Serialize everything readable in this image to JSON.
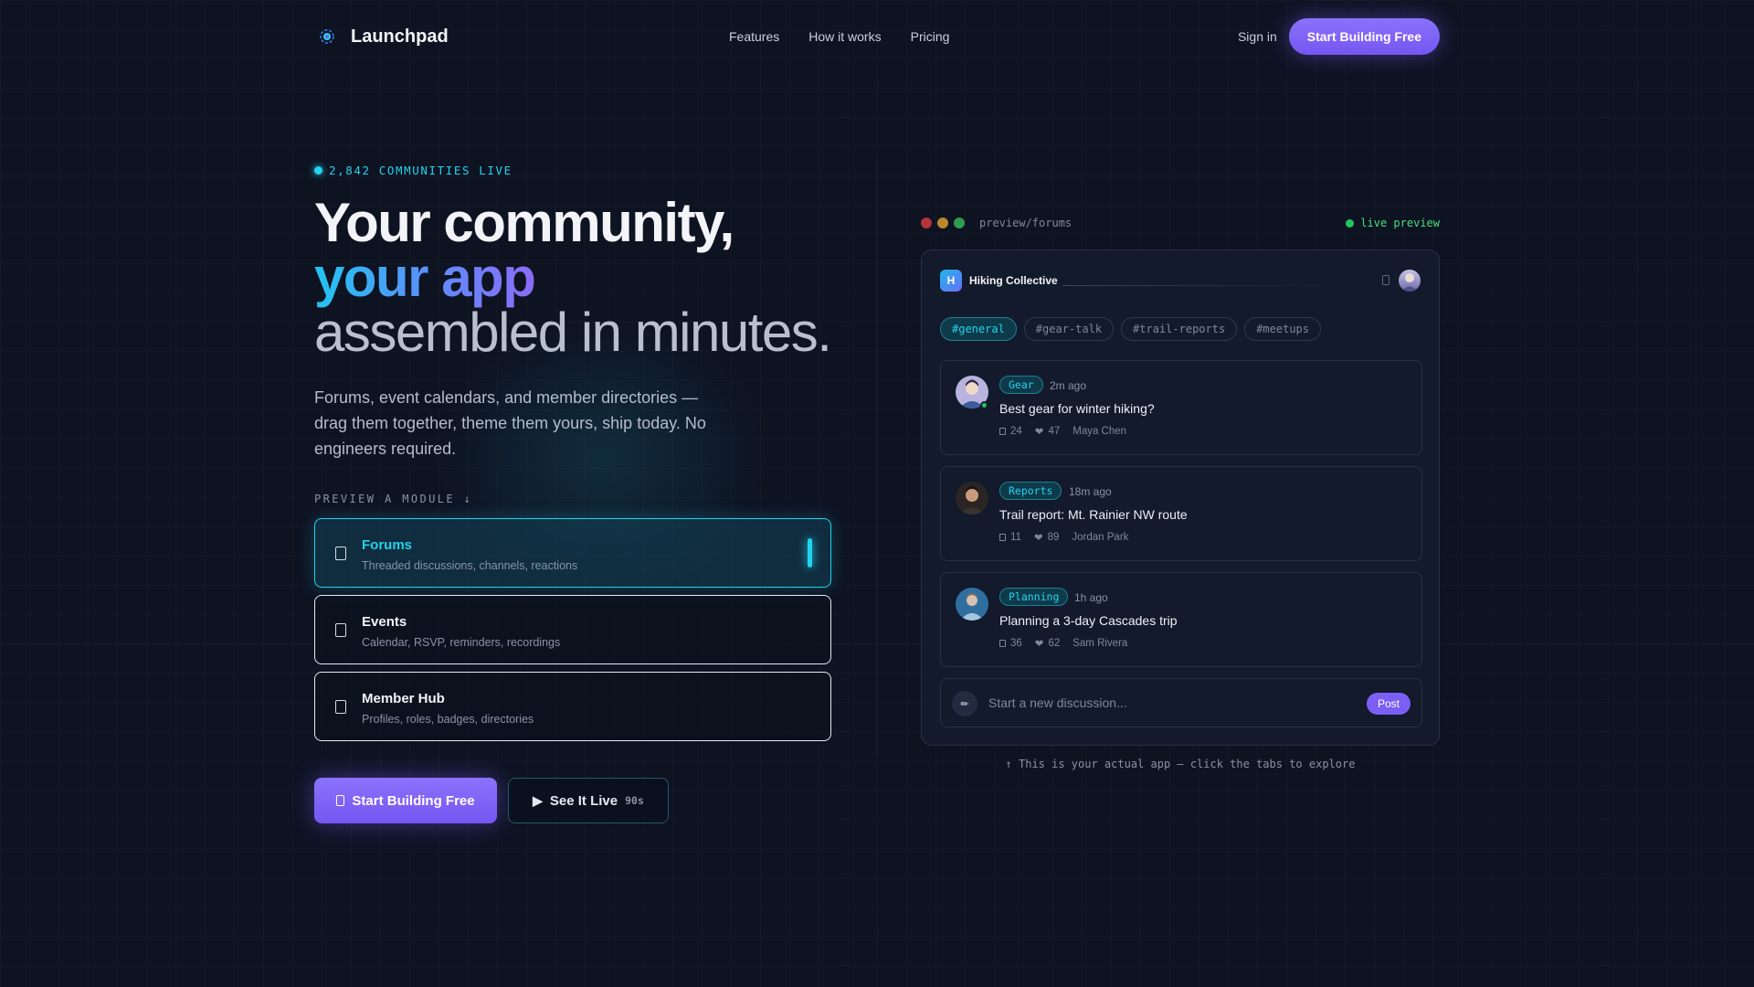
{
  "nav": {
    "brand": "Launchpad",
    "links": [
      "Features",
      "How it works",
      "Pricing"
    ],
    "signin": "Sign in",
    "cta": "Start Building Free"
  },
  "hero": {
    "badge": "2,842 COMMUNITIES LIVE",
    "headline_line1": "Your community,",
    "headline_line2": "your app",
    "headline_line3": "assembled in minutes.",
    "subtext": "Forums, event calendars, and member directories — drag them together, theme them yours, ship today. No engineers required.",
    "preview_label": "PREVIEW A MODULE ↓",
    "modules": [
      {
        "title": "Forums",
        "desc": "Threaded discussions, channels, reactions",
        "active": true
      },
      {
        "title": "Events",
        "desc": "Calendar, RSVP, reminders, recordings",
        "active": false
      },
      {
        "title": "Member Hub",
        "desc": "Profiles, roles, badges, directories",
        "active": false
      }
    ],
    "cta_primary": "Start Building Free",
    "cta_secondary": "See It Live",
    "cta_secondary_duration": "90s"
  },
  "preview": {
    "path": "preview/forums",
    "live_label": "live preview",
    "workspace_initial": "H",
    "workspace_name": "Hiking Collective",
    "channels": [
      "#general",
      "#gear-talk",
      "#trail-reports",
      "#meetups"
    ],
    "active_channel": "#general",
    "posts": [
      {
        "tag": "Gear",
        "time": "2m ago",
        "title": "Best gear for winter hiking?",
        "comments": "24",
        "likes": "47",
        "author": "Maya Chen",
        "online": true
      },
      {
        "tag": "Reports",
        "time": "18m ago",
        "title": "Trail report: Mt. Rainier NW route",
        "comments": "11",
        "likes": "89",
        "author": "Jordan Park",
        "online": false
      },
      {
        "tag": "Planning",
        "time": "1h ago",
        "title": "Planning a 3-day Cascades trip",
        "comments": "36",
        "likes": "62",
        "author": "Sam Rivera",
        "online": false
      }
    ],
    "composer_placeholder": "Start a new discussion...",
    "post_button": "Post",
    "caption": "↑ This is your actual app — click the tabs to explore"
  },
  "colors": {
    "background": "#0e1322",
    "accent_purple": "#7b5ff5",
    "accent_cyan": "#22d3ee",
    "live_green": "#22c55e"
  }
}
